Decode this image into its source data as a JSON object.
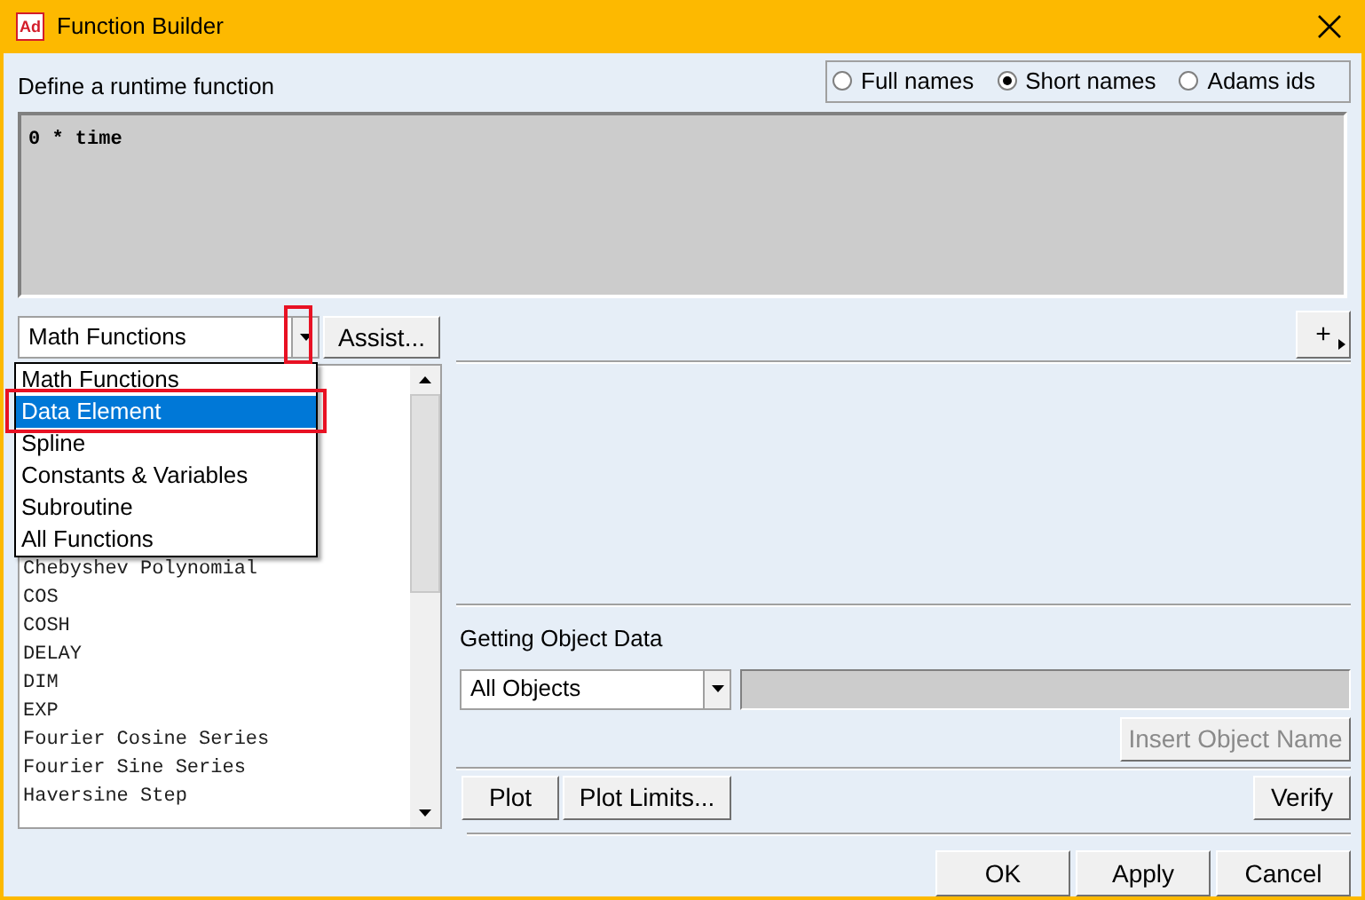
{
  "window": {
    "logo": "Ad",
    "title": "Function Builder"
  },
  "expression": {
    "label": "Define a runtime function",
    "value": "0 * time"
  },
  "name_mode": [
    {
      "label": "Full names",
      "selected": false
    },
    {
      "label": "Short names",
      "selected": true
    },
    {
      "label": "Adams ids",
      "selected": false
    }
  ],
  "category": {
    "value": "Math Functions",
    "expanded": true,
    "options": [
      {
        "label": "Math Functions",
        "highlighted": false
      },
      {
        "label": "Data Element",
        "highlighted": true
      },
      {
        "label": "Spline",
        "highlighted": false
      },
      {
        "label": "Constants & Variables",
        "highlighted": false
      },
      {
        "label": "Subroutine",
        "highlighted": false
      },
      {
        "label": "All Functions",
        "highlighted": false
      }
    ]
  },
  "assist_button": "Assist...",
  "functions": [
    "Chebyshev Polynomial",
    "COS",
    "COSH",
    "DELAY",
    "DIM",
    "EXP",
    "Fourier Cosine Series",
    "Fourier Sine Series",
    "Haversine Step"
  ],
  "add_button": "+",
  "object_data": {
    "label": "Getting Object Data",
    "filter": "All Objects",
    "insert_button": {
      "label": "Insert Object Name",
      "disabled": true
    }
  },
  "plot_buttons": [
    "Plot",
    "Plot Limits..."
  ],
  "verify_button": "Verify",
  "dialog_buttons": [
    "OK",
    "Apply",
    "Cancel"
  ]
}
